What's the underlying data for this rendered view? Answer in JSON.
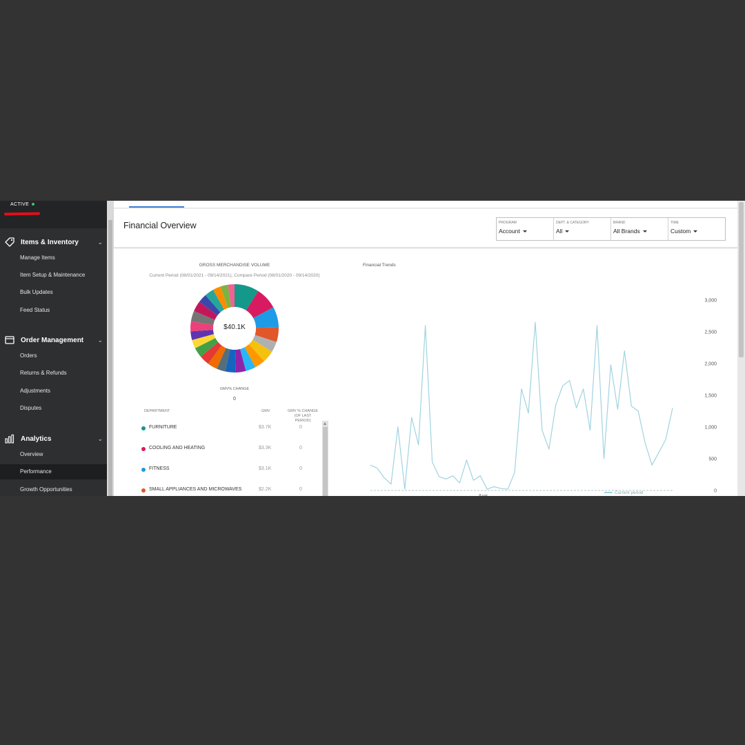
{
  "account": {
    "status": "ACTIVE",
    "status_color": "#3cc46e"
  },
  "sidebar": {
    "sections": [
      {
        "title": "Items & Inventory",
        "icon": "tag-icon",
        "items": [
          "Manage Items",
          "Item Setup & Maintenance",
          "Bulk Updates",
          "Feed Status"
        ]
      },
      {
        "title": "Order Management",
        "icon": "cart-icon",
        "items": [
          "Orders",
          "Returns & Refunds",
          "Adjustments",
          "Disputes"
        ]
      },
      {
        "title": "Analytics",
        "icon": "bar-chart-icon",
        "items": [
          "Overview",
          "Performance",
          "Growth Opportunities"
        ]
      }
    ],
    "active_item": "Performance"
  },
  "header": {
    "title": "Financial Overview",
    "filters": [
      {
        "label": "PROGRAM",
        "value": "Account"
      },
      {
        "label": "DEPT. & CATEGORY",
        "value": "All"
      },
      {
        "label": "BRAND",
        "value": "All Brands"
      },
      {
        "label": "TIME",
        "value": "Custom"
      }
    ]
  },
  "gmv": {
    "title": "GROSS MERCHANDISE VOLUME",
    "period": "Current Period (08/01/2021 - 09/14/2021), Compare Period (08/01/2020 - 09/14/2020)",
    "total": "$40.1K",
    "change_label": "GMV% CHANGE",
    "change_value": "0",
    "table": {
      "headers": {
        "department": "DEPARTMENT",
        "gmv": "GMV",
        "change": "GMV % CHANGE (OF LAST PERIOD)"
      },
      "rows": [
        {
          "department": "FURNITURE",
          "gmv": "$3.7K",
          "change": "0",
          "color": "#13988a"
        },
        {
          "department": "COOLING AND HEATING",
          "gmv": "$3.3K",
          "change": "0",
          "color": "#d81b60"
        },
        {
          "department": "FITNESS",
          "gmv": "$3.1K",
          "change": "0",
          "color": "#1e9be6"
        },
        {
          "department": "SMALL APPLIANCES AND MICROWAVES",
          "gmv": "$2.2K",
          "change": "0",
          "color": "#e0572a"
        }
      ]
    },
    "chart_data": {
      "type": "pie",
      "total_label": "$40.1K",
      "slices": [
        {
          "color": "#13988a",
          "value": 3.7
        },
        {
          "color": "#d81b60",
          "value": 3.3
        },
        {
          "color": "#1e9be6",
          "value": 3.1
        },
        {
          "color": "#e0572a",
          "value": 2.2
        },
        {
          "color": "#b0b0b0",
          "value": 1.6
        },
        {
          "color": "#f4c20d",
          "value": 1.8
        },
        {
          "color": "#ff9800",
          "value": 1.6
        },
        {
          "color": "#29b6f6",
          "value": 1.5
        },
        {
          "color": "#8e24aa",
          "value": 1.5
        },
        {
          "color": "#1565c0",
          "value": 1.6
        },
        {
          "color": "#546e7a",
          "value": 1.3
        },
        {
          "color": "#ef6c00",
          "value": 1.5
        },
        {
          "color": "#e53935",
          "value": 1.5
        },
        {
          "color": "#43a047",
          "value": 1.5
        },
        {
          "color": "#fdd835",
          "value": 1.3
        },
        {
          "color": "#5e35b1",
          "value": 1.3
        },
        {
          "color": "#ec407a",
          "value": 1.5
        },
        {
          "color": "#757575",
          "value": 1.6
        },
        {
          "color": "#c2185b",
          "value": 1.6
        },
        {
          "color": "#3949ab",
          "value": 1.3
        },
        {
          "color": "#26a69a",
          "value": 1.4
        },
        {
          "color": "#fb8c00",
          "value": 1.2
        },
        {
          "color": "#7cb342",
          "value": 1.1
        },
        {
          "color": "#f06292",
          "value": 1.0
        }
      ]
    }
  },
  "trends": {
    "title": "Financial Trends",
    "legend": "Current period",
    "line_color": "#9fd3e0",
    "chart_data": {
      "type": "line",
      "x_tick_label": "Aug",
      "ylim": [
        0,
        3000
      ],
      "y_ticks": [
        "3,000",
        "2,500",
        "2,000",
        "1,500",
        "1,000",
        "500",
        "0"
      ],
      "y_tick_values": [
        3000,
        2500,
        2000,
        1500,
        1000,
        500,
        0
      ],
      "series": [
        {
          "name": "Current period",
          "values": [
            400,
            350,
            200,
            100,
            1000,
            20,
            1150,
            720,
            2600,
            450,
            220,
            180,
            230,
            120,
            480,
            160,
            230,
            20,
            60,
            30,
            20,
            280,
            1600,
            1220,
            2650,
            950,
            650,
            1350,
            1650,
            1730,
            1300,
            1600,
            950,
            2600,
            500,
            1980,
            1280,
            2200,
            1330,
            1250,
            750,
            400,
            600,
            800,
            1300
          ]
        }
      ]
    }
  }
}
